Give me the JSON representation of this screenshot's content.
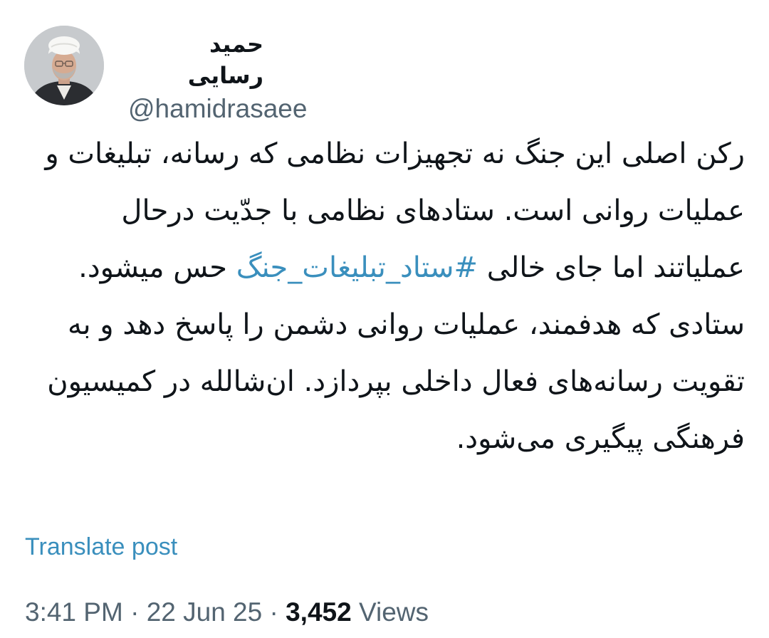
{
  "author": {
    "display_name": "حمید رسایی",
    "handle": "@hamidrasaee"
  },
  "tweet": {
    "text_before": "رکن اصلی این جنگ نه تجهیزات نظامی که رسانه، تبلیغات و عملیات روانی است. ستادهای نظامی با جدّیت درحال عملیاتند اما جای خالی ",
    "hashtag": "#ستاد_تبلیغات_جنگ",
    "text_after": " حس میشود. ستادی که هدفمند، عملیات روانی دشمن را پاسخ دهد و به تقویت رسانه‌های فعال داخلی بپردازد. ان‌شالله در کمیسیون فرهنگی پیگیری می‌شود."
  },
  "translate_label": "Translate post",
  "meta": {
    "time": "3:41 PM",
    "separator": "·",
    "date": "22 Jun 25",
    "views_count": "3,452",
    "views_label": "Views"
  },
  "colors": {
    "text": "#0f1419",
    "secondary": "#536471",
    "link": "#3a8fbd"
  }
}
